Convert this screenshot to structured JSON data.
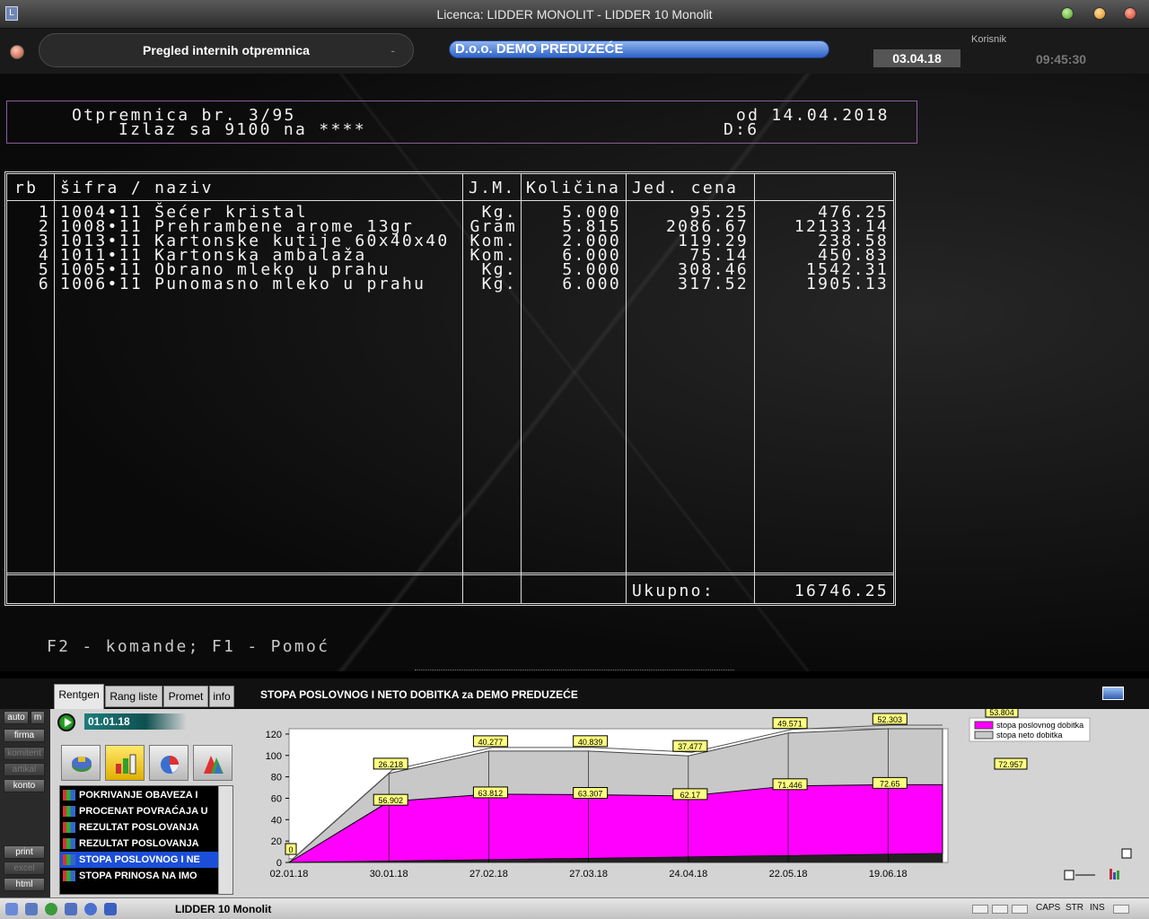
{
  "window": {
    "title": "Licenca: LIDDER MONOLIT - LIDDER 10 Monolit"
  },
  "header": {
    "module": "Pregled internih otpremnica",
    "module_dash": "-",
    "company": "D.o.o. DEMO PREDUZEĆE",
    "user_label": "Korisnik",
    "date": "03.04.18",
    "time": "09:45:30"
  },
  "document": {
    "title": "Otpremnica br. 3/95",
    "exit_line": "Izlaz sa 9100 na ****",
    "date_line": "od 14.04.2018",
    "d_line": "D:6"
  },
  "table": {
    "headers": {
      "rb": "rb",
      "sifra": "šifra / naziv",
      "jm": "J.M.",
      "kolicina": "Količina",
      "cena": "Jed. cena",
      "iznos": ""
    },
    "rows": [
      {
        "rb": "1",
        "name": "1004•11 Šećer kristal",
        "jm": "Kg.",
        "qty": "5.000",
        "price": "95.25",
        "total": "476.25"
      },
      {
        "rb": "2",
        "name": "1008•11 Prehrambene arome 13gr",
        "jm": "Gram",
        "qty": "5.815",
        "price": "2086.67",
        "total": "12133.14"
      },
      {
        "rb": "3",
        "name": "1013•11 Kartonske kutije 60x40x40",
        "jm": "Kom.",
        "qty": "2.000",
        "price": "119.29",
        "total": "238.58"
      },
      {
        "rb": "4",
        "name": "1011•11 Kartonska ambalaža",
        "jm": "Kom.",
        "qty": "6.000",
        "price": "75.14",
        "total": "450.83"
      },
      {
        "rb": "5",
        "name": "1005•11 Obrano mleko u prahu",
        "jm": "Kg.",
        "qty": "5.000",
        "price": "308.46",
        "total": "1542.31"
      },
      {
        "rb": "6",
        "name": "1006•11 Punomasno mleko u prahu",
        "jm": "Kg.",
        "qty": "6.000",
        "price": "317.52",
        "total": "1905.13"
      }
    ],
    "total_label": "Ukupno:",
    "total_value": "16746.25"
  },
  "footer_hint": "F2 - komande; F1 - Pomoć",
  "panel": {
    "tabs": [
      "Rentgen",
      "Rang liste",
      "Promet",
      "info"
    ],
    "left_buttons": [
      "auto",
      "m",
      "firma",
      "komitent",
      "artikal",
      "konto",
      "print",
      "excel",
      "html"
    ],
    "period": "01.01.18",
    "icon_buttons": [
      "finance-icon",
      "bar-chart-icon",
      "pie-chart-icon",
      "area-chart-icon"
    ],
    "reports": [
      "POKRIVANJE OBAVEZA I",
      "PROCENAT POVRAĆAJA U",
      "REZULTAT POSLOVANJA",
      "REZULTAT POSLOVANJA",
      "STOPA POSLOVNOG I NE",
      "STOPA PRINOSA NA IMO"
    ],
    "selected_report_index": 4,
    "chart_title": "STOPA POSLOVNOG I NETO DOBITKA za DEMO PREDUZEĆE"
  },
  "chart_data": {
    "type": "area",
    "title": "STOPA POSLOVNOG I NETO DOBITKA za DEMO PREDUZEĆE",
    "categories": [
      "02.01.18",
      "30.01.18",
      "27.02.18",
      "27.03.18",
      "24.04.18",
      "22.05.18",
      "19.06.18"
    ],
    "yticks": [
      "0",
      "20",
      "40",
      "60",
      "80",
      "100",
      "120"
    ],
    "ylim": [
      0,
      130
    ],
    "stacked": true,
    "series": [
      {
        "name": "stopa poslovnog dobitka",
        "color": "#ff00ff",
        "values": [
          0,
          56.902,
          63.812,
          63.307,
          62.17,
          71.446,
          72.65
        ]
      },
      {
        "name": "stopa neto dobitka",
        "color": "#c8c8c8",
        "values": [
          0,
          26.218,
          40.277,
          40.839,
          37.477,
          49.571,
          52.303
        ]
      }
    ],
    "legend_labels": [
      "53.804",
      "72.957"
    ],
    "legend": "top-right"
  },
  "statusbar": {
    "text": "LIDDER 10 Monolit",
    "keys": [
      "CAPS",
      "STR",
      "INS"
    ]
  }
}
